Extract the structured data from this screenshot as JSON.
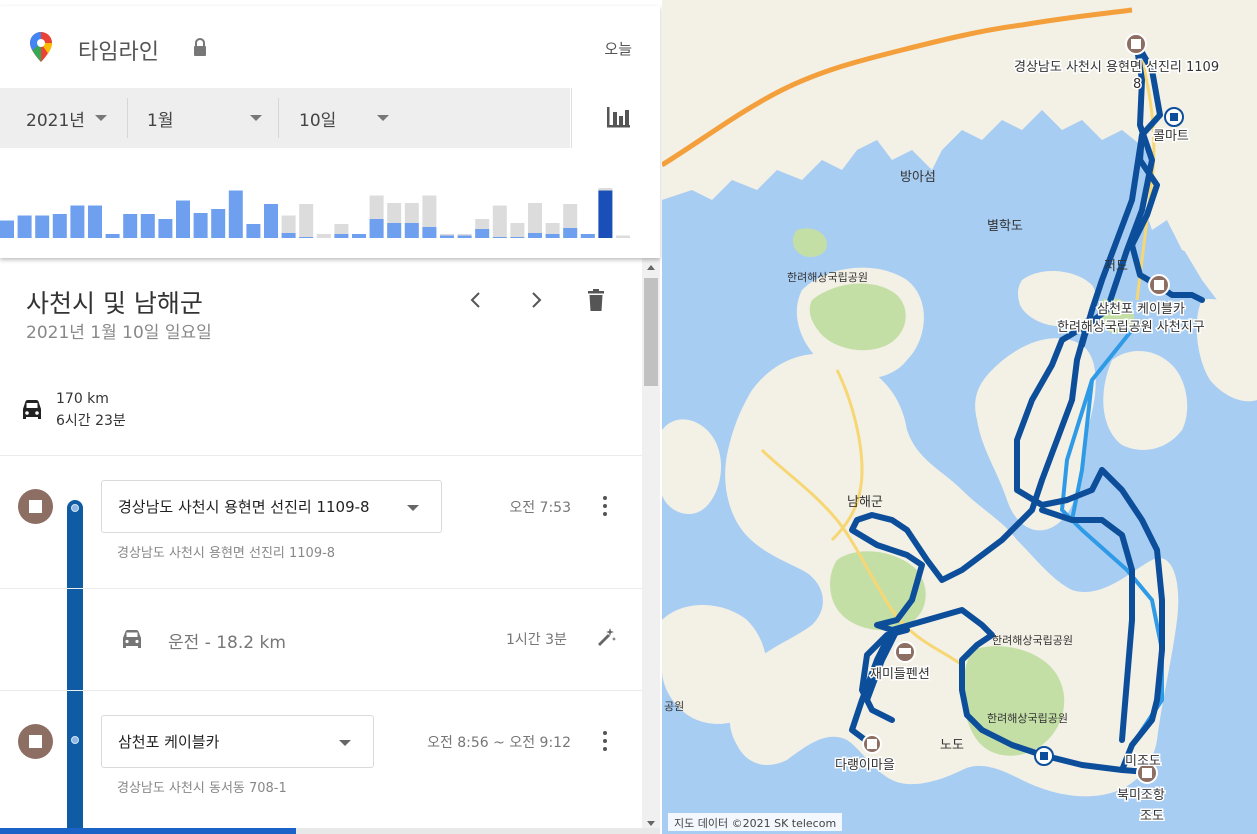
{
  "header": {
    "title": "타임라인",
    "today_label": "오늘"
  },
  "date_picker": {
    "year": "2021년",
    "month": "1월",
    "day": "10일"
  },
  "histogram": {
    "days": [
      {
        "blue": 0.35,
        "gray": 0
      },
      {
        "blue": 0.45,
        "gray": 0
      },
      {
        "blue": 0.45,
        "gray": 0
      },
      {
        "blue": 0.48,
        "gray": 0
      },
      {
        "blue": 0.65,
        "gray": 0
      },
      {
        "blue": 0.65,
        "gray": 0
      },
      {
        "blue": 0.08,
        "gray": 0
      },
      {
        "blue": 0.48,
        "gray": 0
      },
      {
        "blue": 0.48,
        "gray": 0
      },
      {
        "blue": 0.38,
        "gray": 0
      },
      {
        "blue": 0.75,
        "gray": 0
      },
      {
        "blue": 0.5,
        "gray": 0
      },
      {
        "blue": 0.58,
        "gray": 0
      },
      {
        "blue": 0.95,
        "gray": 0
      },
      {
        "blue": 0.28,
        "gray": 0
      },
      {
        "blue": 0.68,
        "gray": 0
      },
      {
        "blue": 0.1,
        "gray": 0.45
      },
      {
        "blue": 0.02,
        "gray": 0.68
      },
      {
        "blue": 0,
        "gray": 0.08
      },
      {
        "blue": 0.08,
        "gray": 0.28
      },
      {
        "blue": 0.08,
        "gray": 0.08
      },
      {
        "blue": 0.38,
        "gray": 0.85
      },
      {
        "blue": 0.3,
        "gray": 0.7
      },
      {
        "blue": 0.3,
        "gray": 0.7
      },
      {
        "blue": 0.22,
        "gray": 0.85
      },
      {
        "blue": 0.05,
        "gray": 0.08
      },
      {
        "blue": 0.05,
        "gray": 0.08
      },
      {
        "blue": 0.18,
        "gray": 0.38
      },
      {
        "blue": 0.02,
        "gray": 0.65
      },
      {
        "blue": 0.02,
        "gray": 0.3
      },
      {
        "blue": 0.1,
        "gray": 0.7
      },
      {
        "blue": 0.08,
        "gray": 0.3
      },
      {
        "blue": 0.2,
        "gray": 0.68
      },
      {
        "blue": 0.08,
        "gray": 0.08
      },
      {
        "blue": 0.95,
        "gray": 1.0,
        "selected": true
      },
      {
        "blue": 0,
        "gray": 0.05
      }
    ],
    "colors": {
      "blue": "#6fa0ef",
      "gray": "#dcdcdc",
      "selected": "#1b4fb8"
    }
  },
  "day": {
    "title": "사천시 및 남해군",
    "date": "2021년 1월 10일 일요일",
    "distance": "170 km",
    "duration": "6시간 23분"
  },
  "timeline": {
    "places": [
      {
        "name": "경상남도 사천시 용현면 선진리 1109-8",
        "address": "경상남도 사천시 용현면 선진리 1109-8",
        "time": "오전 7:53"
      },
      {
        "name": "삼천포 케이블카",
        "address": "경상남도 사천시 동서동 708-1",
        "time": "오전 8:56 ~ 오전 9:12"
      }
    ],
    "drive": {
      "label": "운전",
      "distance": "- 18.2 km",
      "duration": "1시간 3분"
    }
  },
  "map": {
    "labels": {
      "start": "경상남도 사천시 용현면 선진리 1109",
      "start2": "8",
      "mart": "콜마트",
      "bangasum": "방아섬",
      "byeolhakdo": "별학도",
      "jeodo": "저도",
      "park1": "한려해상국립공원",
      "cablecar": "삼천포 케이블카",
      "park_sacheon": "한려해상국립공원 사천지구",
      "namhae": "남해군",
      "park2": "한려해상국립공원",
      "park3": "한려해상국립공원",
      "pension": "재미들펜션",
      "village": "다랭이마을",
      "park_edge": "공원",
      "nodo": "노도",
      "mijodo": "미조도",
      "bukmijo": "북미조항",
      "jodo": "조도"
    },
    "attribution": "지도 데이터 ©2021 SK telecom",
    "colors": {
      "sea": "#a8cdf2",
      "land": "#f3f0e6",
      "park": "#c4dfa6",
      "route": "#0d4e9a",
      "route_light": "#2f9ae6"
    }
  }
}
